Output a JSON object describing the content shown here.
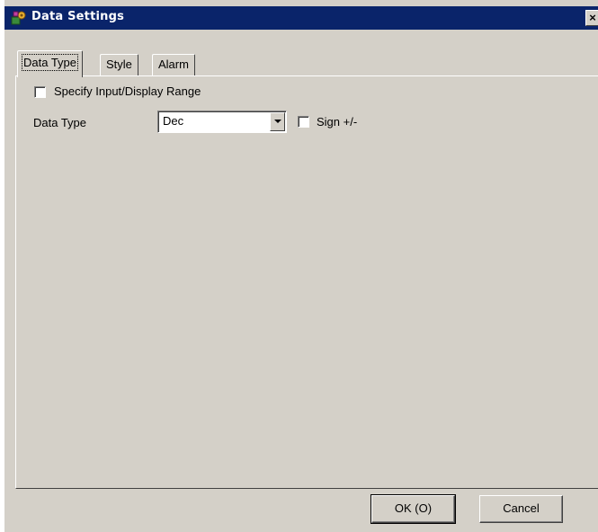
{
  "window": {
    "title": "Data Settings",
    "close_label": "×",
    "icon": "settings-app-icon"
  },
  "tabs": [
    {
      "label": "Data Type",
      "active": true
    },
    {
      "label": "Style",
      "active": false
    },
    {
      "label": "Alarm",
      "active": false
    }
  ],
  "data_type_tab": {
    "specify_range": {
      "label": "Specify Input/Display Range",
      "checked": false
    },
    "data_type_label": "Data Type",
    "data_type_value": "Dec",
    "sign": {
      "label": "Sign +/-",
      "checked": false
    }
  },
  "buttons": {
    "ok": "OK (O)",
    "cancel": "Cancel"
  },
  "colors": {
    "titlebar": "#0a246a",
    "dialog_face": "#d4d0c8"
  }
}
